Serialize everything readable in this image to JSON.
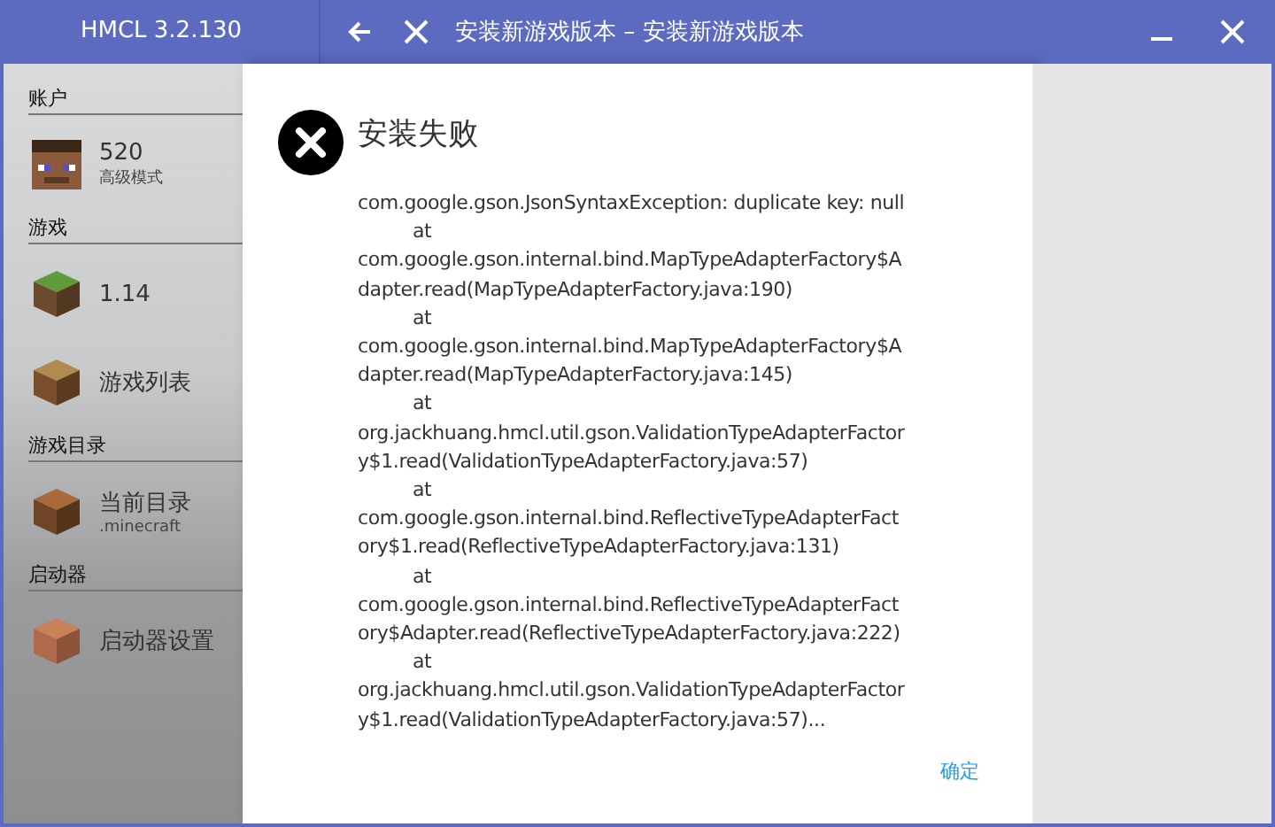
{
  "window": {
    "app_title": "HMCL 3.2.130",
    "title": "安装新游戏版本 – 安装新游戏版本"
  },
  "sidebar": {
    "sections": [
      {
        "header": "账户",
        "items": [
          {
            "label": "520",
            "sublabel": "高级模式"
          }
        ]
      },
      {
        "header": "游戏",
        "items": [
          {
            "label": "1.14"
          },
          {
            "label": "游戏列表"
          }
        ]
      },
      {
        "header": "游戏目录",
        "items": [
          {
            "label": "当前目录",
            "sublabel": ".minecraft"
          }
        ]
      },
      {
        "header": "启动器",
        "items": [
          {
            "label": "启动器设置"
          }
        ]
      }
    ]
  },
  "dialog": {
    "title": "安装失败",
    "lines": [
      {
        "text": "com.google.gson.JsonSyntaxException: duplicate key: null",
        "indented": false
      },
      {
        "text": "at",
        "indented": true
      },
      {
        "text": "com.google.gson.internal.bind.MapTypeAdapterFactory$A",
        "indented": false
      },
      {
        "text": "dapter.read(MapTypeAdapterFactory.java:190)",
        "indented": false
      },
      {
        "text": "at",
        "indented": true
      },
      {
        "text": "com.google.gson.internal.bind.MapTypeAdapterFactory$A",
        "indented": false
      },
      {
        "text": "dapter.read(MapTypeAdapterFactory.java:145)",
        "indented": false
      },
      {
        "text": "at",
        "indented": true
      },
      {
        "text": "org.jackhuang.hmcl.util.gson.ValidationTypeAdapterFactor",
        "indented": false
      },
      {
        "text": "y$1.read(ValidationTypeAdapterFactory.java:57)",
        "indented": false
      },
      {
        "text": "at",
        "indented": true
      },
      {
        "text": "com.google.gson.internal.bind.ReflectiveTypeAdapterFact",
        "indented": false
      },
      {
        "text": "ory$1.read(ReflectiveTypeAdapterFactory.java:131)",
        "indented": false
      },
      {
        "text": "at",
        "indented": true
      },
      {
        "text": "com.google.gson.internal.bind.ReflectiveTypeAdapterFact",
        "indented": false
      },
      {
        "text": "ory$Adapter.read(ReflectiveTypeAdapterFactory.java:222)",
        "indented": false
      },
      {
        "text": "at",
        "indented": true
      },
      {
        "text": "org.jackhuang.hmcl.util.gson.ValidationTypeAdapterFactor",
        "indented": false
      },
      {
        "text": "y$1.read(ValidationTypeAdapterFactory.java:57)...",
        "indented": false
      }
    ],
    "button": "确定"
  }
}
